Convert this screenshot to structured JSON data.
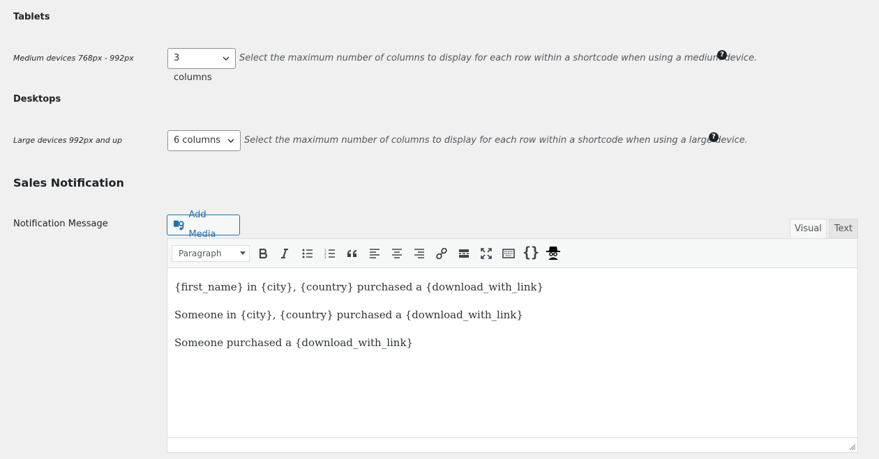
{
  "tablets": {
    "heading": "Tablets",
    "row_label": "Medium devices 768px - 992px",
    "select_value": "3 columns",
    "description": "Select the maximum number of columns to display for each row within a shortcode when using a medium device.",
    "help": "?"
  },
  "desktops": {
    "heading": "Desktops",
    "row_label": "Large devices 992px and up",
    "select_value": "6 columns",
    "description": "Select the maximum number of columns to display for each row within a shortcode when using a large device.",
    "help": "?"
  },
  "sales": {
    "heading": "Sales Notification",
    "field_label": "Notification Message",
    "add_media": "Add Media",
    "tabs": {
      "visual": "Visual",
      "text": "Text"
    },
    "format_select": "Paragraph",
    "toolbar_icons": [
      "bold-icon",
      "italic-icon",
      "bullet-list-icon",
      "numbered-list-icon",
      "blockquote-icon",
      "align-left-icon",
      "align-center-icon",
      "align-right-icon",
      "link-icon",
      "read-more-icon",
      "fullscreen-icon",
      "toolbar-toggle-icon",
      "shortcode-braces-icon",
      "spy-icon"
    ],
    "lines": [
      "{first_name} in {city}, {country} purchased a {download_with_link}",
      "Someone in {city}, {country} purchased a {download_with_link}",
      "Someone purchased a {download_with_link}"
    ]
  }
}
